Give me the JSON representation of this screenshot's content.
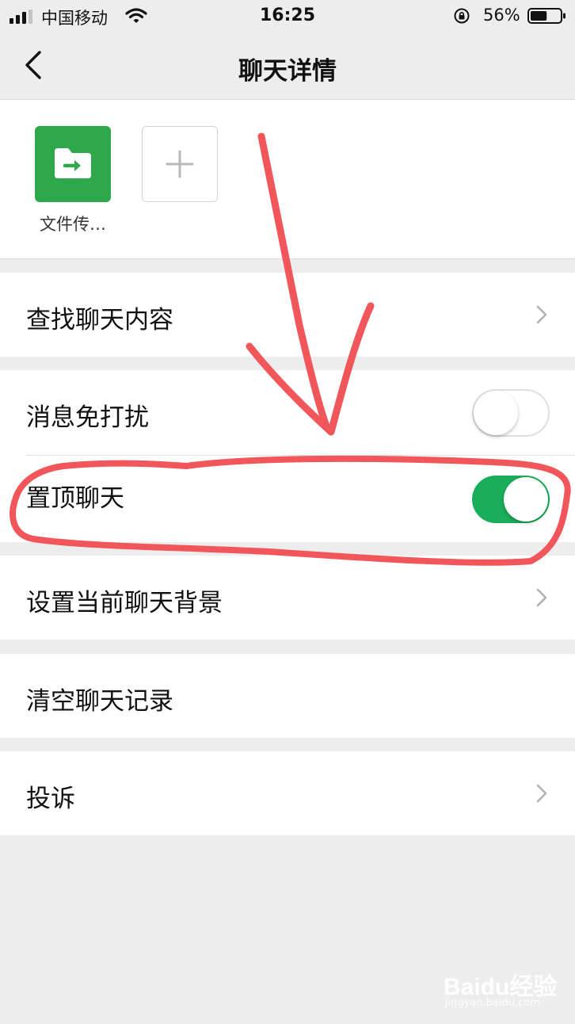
{
  "status_bar": {
    "carrier": "中国移动",
    "time": "16:25",
    "battery_percent": "56%",
    "signal_icon": "signal-bars-icon",
    "wifi_icon": "wifi-icon",
    "lock_icon": "rotation-lock-icon",
    "battery_icon": "battery-icon",
    "battery_level": 0.56
  },
  "nav": {
    "title": "聊天详情",
    "back_icon": "chevron-left-icon"
  },
  "members": {
    "items": [
      {
        "name": "文件传…",
        "icon": "folder-transfer-icon",
        "color": "#2ea84b"
      }
    ],
    "add_icon": "plus-icon"
  },
  "cells": {
    "search_chat": "查找聊天内容",
    "mute": "消息免打扰",
    "mute_on": false,
    "pin": "置顶聊天",
    "pin_on": true,
    "background": "设置当前聊天背景",
    "clear": "清空聊天记录",
    "report": "投诉"
  },
  "colors": {
    "accent_green": "#1aad5a",
    "annotation_red": "#f0565a",
    "background": "#ededed"
  },
  "watermark": {
    "brand": "Baidu经验",
    "url": "jingyan.baidu.com"
  }
}
